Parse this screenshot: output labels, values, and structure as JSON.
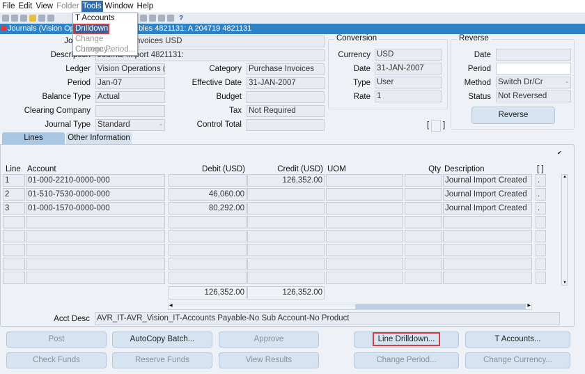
{
  "menubar": [
    "File",
    "Edit",
    "View",
    "Folder",
    "Tools",
    "Window",
    "Help"
  ],
  "tools_menu": [
    {
      "label": "T Accounts",
      "enabled": true
    },
    {
      "label": "Drilldown",
      "enabled": true,
      "highlighted": true
    },
    {
      "label": "Change Currency...",
      "enabled": false
    },
    {
      "label": "Change Period...",
      "enabled": false
    }
  ],
  "toolbar": {
    "help": "?"
  },
  "window": {
    "title_left": "Journals (Vision Ope",
    "title_right": "bles 4821131: A 204719 4821131"
  },
  "header": {
    "journal": {
      "label": "Journal",
      "value": "Purchase Invoices USD"
    },
    "description": {
      "label": "Description",
      "value": "Journal Import 4821131:"
    },
    "ledger": {
      "label": "Ledger",
      "value": "Vision Operations (U"
    },
    "period": {
      "label": "Period",
      "value": "Jan-07"
    },
    "balance_type": {
      "label": "Balance Type",
      "value": "Actual"
    },
    "clearing_company": {
      "label": "Clearing Company",
      "value": ""
    },
    "journal_type": {
      "label": "Journal Type",
      "value": "Standard"
    },
    "category": {
      "label": "Category",
      "value": "Purchase Invoices"
    },
    "effective_date": {
      "label": "Effective Date",
      "value": "31-JAN-2007"
    },
    "budget": {
      "label": "Budget",
      "value": ""
    },
    "tax": {
      "label": "Tax",
      "value": "Not Required"
    },
    "control_total": {
      "label": "Control Total",
      "value": ""
    }
  },
  "conversion": {
    "title": "Conversion",
    "currency_label": "Currency",
    "currency": "USD",
    "date_label": "Date",
    "date": "31-JAN-2007",
    "type_label": "Type",
    "type": "User",
    "rate_label": "Rate",
    "rate": "1"
  },
  "reverse": {
    "title": "Reverse",
    "date_label": "Date",
    "date": "",
    "period_label": "Period",
    "period": "",
    "method_label": "Method",
    "method": "Switch Dr/Cr",
    "status_label": "Status",
    "status": "Not Reversed",
    "button": "Reverse"
  },
  "bracket": "[ ]",
  "tabs": [
    "Lines",
    "Other Information"
  ],
  "lines": {
    "columns": [
      "Line",
      "Account",
      "Debit (USD)",
      "Credit (USD)",
      "UOM",
      "Qty",
      "Description",
      "[ ]"
    ],
    "rows": [
      {
        "line": "1",
        "account": "01-000-2210-0000-000",
        "debit": "",
        "credit": "126,352.00",
        "uom": "",
        "qty": "",
        "description": "Journal Import Created",
        "flag": "."
      },
      {
        "line": "2",
        "account": "01-510-7530-0000-000",
        "debit": "46,060.00",
        "credit": "",
        "uom": "",
        "qty": "",
        "description": "Journal Import Created",
        "flag": "."
      },
      {
        "line": "3",
        "account": "01-000-1570-0000-000",
        "debit": "80,292.00",
        "credit": "",
        "uom": "",
        "qty": "",
        "description": "Journal Import Created",
        "flag": "."
      }
    ],
    "total_debit": "126,352.00",
    "total_credit": "126,352.00"
  },
  "acct_desc": {
    "label": "Acct Desc",
    "value": "AVR_IT-AVR_Vision_IT-Accounts Payable-No Sub Account-No Product"
  },
  "buttons": [
    {
      "label": "Post",
      "enabled": false
    },
    {
      "label": "AutoCopy Batch...",
      "enabled": true
    },
    {
      "label": "Approve",
      "enabled": false
    },
    {
      "label": "Line Drilldown...",
      "enabled": true,
      "highlighted": true
    },
    {
      "label": "T Accounts...",
      "enabled": true
    },
    {
      "label": "Check Funds",
      "enabled": false
    },
    {
      "label": "Reserve Funds",
      "enabled": false
    },
    {
      "label": "View Results",
      "enabled": false
    },
    {
      "label": "Change Period...",
      "enabled": false
    },
    {
      "label": "Change Currency...",
      "enabled": false
    }
  ],
  "colors": {
    "title_bar": "#2f82c3",
    "highlight_outline": "#d04040",
    "button": "#d6e4f1"
  }
}
